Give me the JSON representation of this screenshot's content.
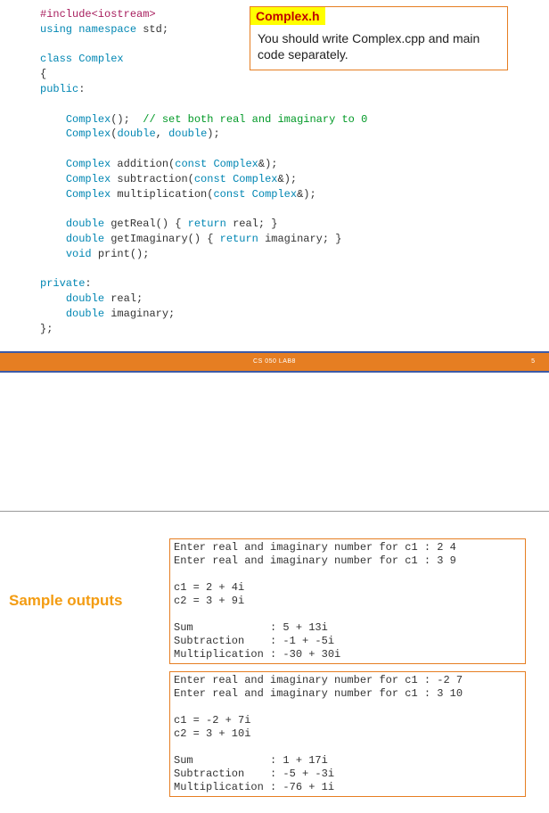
{
  "callout": {
    "title": "Complex.h",
    "body": "You should write Complex.cpp and main code separately."
  },
  "code": {
    "l1_a": "#include",
    "l1_b": "<iostream>",
    "l2_a": "using",
    "l2_b": "namespace",
    "l2_c": "std",
    "l2_d": ";",
    "l4_a": "class",
    "l4_b": "Complex",
    "l5": "{",
    "l6_a": "public",
    "l6_b": ":",
    "l8_a": "Complex",
    "l8_b": "();",
    "l8_c": "  // set both real and imaginary to 0",
    "l9_a": "Complex",
    "l9_b": "(",
    "l9_c": "double",
    "l9_d": ",",
    "l9_e": "double",
    "l9_f": ");",
    "l11_a": "Complex",
    "l11_b": " addition(",
    "l11_c": "const",
    "l11_d": "Complex",
    "l11_e": "&);",
    "l12_a": "Complex",
    "l12_b": " subtraction(",
    "l12_c": "const",
    "l12_d": "Complex",
    "l12_e": "&);",
    "l13_a": "Complex",
    "l13_b": " multiplication(",
    "l13_c": "const",
    "l13_d": "Complex",
    "l13_e": "&);",
    "l15_a": "double",
    "l15_b": " getReal() { ",
    "l15_c": "return",
    "l15_d": " real; }",
    "l16_a": "double",
    "l16_b": " getImaginary() { ",
    "l16_c": "return",
    "l16_d": " imaginary; }",
    "l17_a": "void",
    "l17_b": " print();",
    "l19_a": "private",
    "l19_b": ":",
    "l20_a": "double",
    "l20_b": " real;",
    "l21_a": "double",
    "l21_b": " imaginary;",
    "l22": "};"
  },
  "bar": {
    "text": "CS 050 LAB8",
    "page": "5"
  },
  "sample_label": "Sample outputs",
  "output1": "Enter real and imaginary number for c1 : 2 4\nEnter real and imaginary number for c1 : 3 9\n\nc1 = 2 + 4i\nc2 = 3 + 9i\n\nSum            : 5 + 13i\nSubtraction    : -1 + -5i\nMultiplication : -30 + 30i",
  "output2": "Enter real and imaginary number for c1 : -2 7\nEnter real and imaginary number for c1 : 3 10\n\nc1 = -2 + 7i\nc2 = 3 + 10i\n\nSum            : 1 + 17i\nSubtraction    : -5 + -3i\nMultiplication : -76 + 1i"
}
